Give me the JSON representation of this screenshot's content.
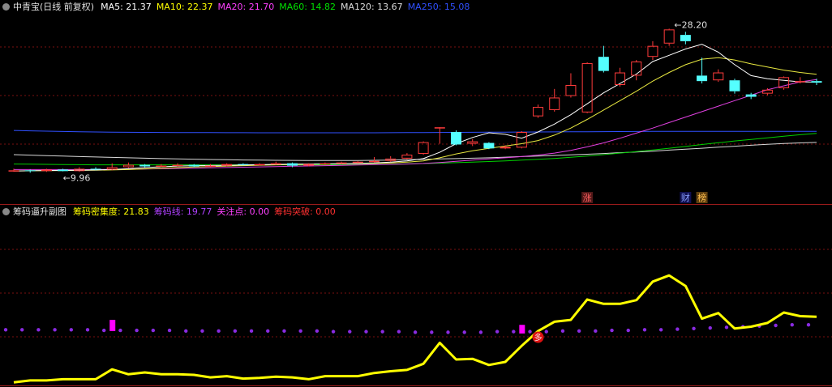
{
  "main_header": {
    "title": "中青宝(日线 前复权)",
    "ma": [
      {
        "label": "MA5: 21.37",
        "color": "#ffffff"
      },
      {
        "label": "MA10: 22.37",
        "color": "#ffff00"
      },
      {
        "label": "MA20: 21.70",
        "color": "#ff40ff"
      },
      {
        "label": "MA60: 14.82",
        "color": "#00e000"
      },
      {
        "label": "MA120: 13.67",
        "color": "#dddddd"
      },
      {
        "label": "MA250: 15.08",
        "color": "#3050ff"
      }
    ]
  },
  "sub_header": {
    "title": "筹码逼升副图",
    "items": [
      {
        "label": "筹码密集度: 21.83",
        "color": "#ffff00"
      },
      {
        "label": "筹码线: 19.77",
        "color": "#b040ff"
      },
      {
        "label": "关注点: 0.00",
        "color": "#ff40ff"
      },
      {
        "label": "筹码突破: 0.00",
        "color": "#ff3030"
      }
    ]
  },
  "chart_data": [
    {
      "type": "candlestick",
      "ylim": [
        6,
        30
      ],
      "annotations": [
        {
          "text": "28.20",
          "i": 41,
          "price": 28.2
        },
        {
          "text": "9.96",
          "i": 3,
          "price": 9.96
        }
      ],
      "markers": [
        {
          "text": "涨",
          "i": 35,
          "bg": "#501818",
          "color": "#ff6060"
        },
        {
          "text": "财",
          "i": 41,
          "bg": "#101050",
          "color": "#8aa0ff"
        },
        {
          "text": "榜",
          "i": 42,
          "bg": "#604010",
          "color": "#ffc050"
        }
      ],
      "candles": [
        [
          10.0,
          10.1,
          10.3,
          9.9
        ],
        [
          10.1,
          10.0,
          10.2,
          9.8
        ],
        [
          10.0,
          10.2,
          10.3,
          9.9
        ],
        [
          10.2,
          10.0,
          10.3,
          9.96
        ],
        [
          10.0,
          10.3,
          10.5,
          9.9
        ],
        [
          10.3,
          10.2,
          10.5,
          10.1
        ],
        [
          10.2,
          10.5,
          11.0,
          10.1
        ],
        [
          10.5,
          10.8,
          11.1,
          10.4
        ],
        [
          10.8,
          10.6,
          10.9,
          10.5
        ],
        [
          10.6,
          10.7,
          10.9,
          10.5
        ],
        [
          10.7,
          10.8,
          11.0,
          10.6
        ],
        [
          10.8,
          10.6,
          10.9,
          10.5
        ],
        [
          10.6,
          10.7,
          10.9,
          10.5
        ],
        [
          10.7,
          10.9,
          11.0,
          10.6
        ],
        [
          10.9,
          10.8,
          11.0,
          10.7
        ],
        [
          10.8,
          10.9,
          11.0,
          10.7
        ],
        [
          10.9,
          11.0,
          11.2,
          10.8
        ],
        [
          11.0,
          10.7,
          11.1,
          10.5
        ],
        [
          10.7,
          10.9,
          11.0,
          10.6
        ],
        [
          10.9,
          11.0,
          11.1,
          10.8
        ],
        [
          11.0,
          11.1,
          11.2,
          10.9
        ],
        [
          11.1,
          11.2,
          11.3,
          11.0
        ],
        [
          11.2,
          11.3,
          11.8,
          11.1
        ],
        [
          11.3,
          11.6,
          11.9,
          11.2
        ],
        [
          11.6,
          12.1,
          12.3,
          11.5
        ],
        [
          12.2,
          13.7,
          13.8,
          12.1
        ],
        [
          15.6,
          15.6,
          15.6,
          13.5
        ],
        [
          15.0,
          13.4,
          15.2,
          13.3
        ],
        [
          13.5,
          13.8,
          14.1,
          13.2
        ],
        [
          13.6,
          12.9,
          13.7,
          12.8
        ],
        [
          12.9,
          13.1,
          13.3,
          12.8
        ],
        [
          13.0,
          15.0,
          15.1,
          12.9
        ],
        [
          17.0,
          18.2,
          18.5,
          16.8
        ],
        [
          17.8,
          19.4,
          20.5,
          17.6
        ],
        [
          19.6,
          21.0,
          22.5,
          19.4
        ],
        [
          17.5,
          23.8,
          23.9,
          17.4
        ],
        [
          24.6,
          22.8,
          26.0,
          22.6
        ],
        [
          21.0,
          22.6,
          23.2,
          20.8
        ],
        [
          22.2,
          24.0,
          24.2,
          21.6
        ],
        [
          24.6,
          26.0,
          26.6,
          24.2
        ],
        [
          26.3,
          28.1,
          28.2,
          26.0
        ],
        [
          27.4,
          26.6,
          27.8,
          26.2
        ],
        [
          22.2,
          21.5,
          24.5,
          21.2
        ],
        [
          21.6,
          22.6,
          23.0,
          21.4
        ],
        [
          21.6,
          20.2,
          21.8,
          19.9
        ],
        [
          19.8,
          19.5,
          20.0,
          19.2
        ],
        [
          19.9,
          20.4,
          20.6,
          19.7
        ],
        [
          20.6,
          22.0,
          22.1,
          20.4
        ],
        [
          21.5,
          21.5,
          22.0,
          21.2
        ],
        [
          21.5,
          21.3,
          21.8,
          21.0
        ]
      ],
      "ma5": [
        10.0,
        10.05,
        10.08,
        10.1,
        10.12,
        10.15,
        10.2,
        10.3,
        10.45,
        10.55,
        10.65,
        10.7,
        10.72,
        10.74,
        10.78,
        10.82,
        10.86,
        10.88,
        10.9,
        10.92,
        10.95,
        11.0,
        11.05,
        11.15,
        11.3,
        11.6,
        12.4,
        13.5,
        14.3,
        14.9,
        14.7,
        14.2,
        15.0,
        16.0,
        17.2,
        18.6,
        20.0,
        21.2,
        22.4,
        24.0,
        24.8,
        25.6,
        26.2,
        25.2,
        23.6,
        22.2,
        21.8,
        21.6,
        21.4,
        21.37
      ],
      "ma10": [
        10.0,
        10.03,
        10.06,
        10.08,
        10.1,
        10.12,
        10.15,
        10.2,
        10.28,
        10.36,
        10.45,
        10.52,
        10.58,
        10.64,
        10.7,
        10.75,
        10.8,
        10.84,
        10.87,
        10.9,
        10.93,
        10.96,
        11.0,
        11.05,
        11.15,
        11.3,
        11.7,
        12.2,
        12.6,
        12.9,
        13.2,
        13.5,
        13.9,
        14.6,
        15.5,
        16.6,
        17.8,
        19.0,
        20.2,
        21.5,
        22.6,
        23.6,
        24.3,
        24.5,
        24.2,
        23.7,
        23.3,
        22.9,
        22.6,
        22.37
      ],
      "ma20": [
        10.2,
        10.2,
        10.2,
        10.2,
        10.2,
        10.2,
        10.22,
        10.24,
        10.27,
        10.3,
        10.34,
        10.38,
        10.42,
        10.46,
        10.5,
        10.54,
        10.58,
        10.62,
        10.66,
        10.7,
        10.74,
        10.78,
        10.82,
        10.86,
        10.9,
        10.98,
        11.1,
        11.25,
        11.4,
        11.55,
        11.7,
        11.85,
        12.05,
        12.3,
        12.65,
        13.1,
        13.6,
        14.2,
        14.85,
        15.5,
        16.2,
        16.9,
        17.6,
        18.3,
        19.0,
        19.7,
        20.4,
        20.9,
        21.4,
        21.7
      ],
      "ma60": [
        10.9,
        10.88,
        10.86,
        10.84,
        10.82,
        10.8,
        10.8,
        10.8,
        10.8,
        10.8,
        10.8,
        10.8,
        10.8,
        10.8,
        10.8,
        10.8,
        10.8,
        10.8,
        10.8,
        10.8,
        10.8,
        10.82,
        10.85,
        10.88,
        10.92,
        10.97,
        11.02,
        11.08,
        11.15,
        11.22,
        11.3,
        11.4,
        11.5,
        11.62,
        11.76,
        11.92,
        12.1,
        12.3,
        12.5,
        12.7,
        12.92,
        13.15,
        13.4,
        13.62,
        13.85,
        14.05,
        14.25,
        14.45,
        14.65,
        14.82
      ],
      "ma120": [
        12.1,
        12.04,
        11.98,
        11.92,
        11.86,
        11.8,
        11.75,
        11.7,
        11.65,
        11.6,
        11.56,
        11.52,
        11.48,
        11.45,
        11.42,
        11.4,
        11.38,
        11.37,
        11.36,
        11.35,
        11.35,
        11.36,
        11.38,
        11.4,
        11.45,
        11.5,
        11.55,
        11.6,
        11.65,
        11.7,
        11.78,
        11.85,
        11.92,
        12.0,
        12.08,
        12.16,
        12.25,
        12.35,
        12.45,
        12.55,
        12.68,
        12.8,
        12.92,
        13.05,
        13.18,
        13.3,
        13.42,
        13.52,
        13.6,
        13.67
      ],
      "ma250": [
        15.2,
        15.15,
        15.1,
        15.06,
        15.02,
        15.0,
        14.98,
        14.96,
        14.95,
        14.94,
        14.93,
        14.92,
        14.92,
        14.91,
        14.91,
        14.9,
        14.9,
        14.9,
        14.9,
        14.9,
        14.9,
        14.9,
        14.9,
        14.91,
        14.92,
        14.93,
        14.94,
        14.95,
        14.96,
        14.97,
        14.98,
        14.99,
        15.0,
        15.01,
        15.02,
        15.03,
        15.04,
        15.05,
        15.06,
        15.07,
        15.07,
        15.08,
        15.08,
        15.08,
        15.08,
        15.08,
        15.08,
        15.08,
        15.08,
        15.08
      ]
    },
    {
      "type": "line",
      "ylim": [
        0,
        27
      ],
      "series": [
        {
          "name": "筹码密集度",
          "values": [
            0.5,
            0.8,
            0.8,
            1.0,
            1.0,
            1.0,
            2.6,
            1.8,
            2.1,
            1.8,
            1.8,
            1.7,
            1.3,
            1.5,
            1.1,
            1.2,
            1.4,
            1.3,
            1.0,
            1.5,
            1.5,
            1.5,
            2.0,
            2.3,
            2.5,
            3.5,
            6.9,
            4.2,
            4.3,
            3.3,
            3.8,
            6.4,
            8.8,
            10.3,
            10.6,
            13.9,
            13.2,
            13.2,
            13.8,
            16.8,
            17.8,
            16.1,
            10.8,
            11.7,
            9.2,
            9.5,
            10.1,
            11.8,
            11.2,
            11.1
          ]
        },
        {
          "name": "筹码线",
          "values": [
            9.0,
            9.0,
            9.0,
            9.0,
            9.0,
            9.0,
            8.9,
            8.9,
            8.9,
            8.9,
            8.9,
            8.8,
            8.8,
            8.8,
            8.8,
            8.8,
            8.8,
            8.8,
            8.8,
            8.8,
            8.7,
            8.7,
            8.7,
            8.7,
            8.7,
            8.6,
            8.6,
            8.6,
            8.6,
            8.6,
            8.7,
            8.7,
            8.7,
            8.7,
            8.8,
            8.8,
            8.8,
            8.9,
            8.9,
            9.0,
            9.0,
            9.1,
            9.2,
            9.3,
            9.4,
            9.5,
            9.6,
            9.7,
            9.8,
            9.8
          ]
        }
      ],
      "bars": [
        {
          "i": 6,
          "top": 10.6,
          "bottom": 8.8
        },
        {
          "i": 31,
          "top": 9.8,
          "bottom": 8.4
        }
      ],
      "markers": [
        {
          "text": "多",
          "i": 32,
          "value": 7.8
        }
      ]
    }
  ]
}
